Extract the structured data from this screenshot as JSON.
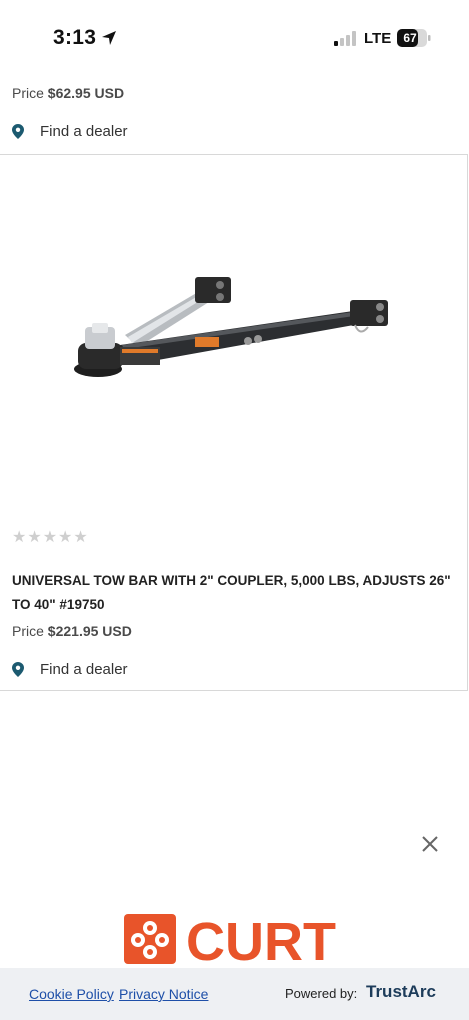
{
  "status_bar": {
    "time": "3:13",
    "network": "LTE",
    "battery": "67"
  },
  "prev_product": {
    "price_label": "Price",
    "price": "$62.95 USD",
    "dealer_link": "Find a dealer"
  },
  "product": {
    "rating_stars": "★★★★★",
    "rating_value": 0,
    "title": "UNIVERSAL TOW BAR WITH 2\" COUPLER, 5,000 LBS, ADJUSTS 26\" TO 40\" #19750",
    "price_label": "Price",
    "price": "$221.95 USD",
    "dealer_link": "Find a dealer"
  },
  "brand": {
    "logo_text": "CURT",
    "logo_color": "#e8542a"
  },
  "cookie_footer": {
    "cookie_policy": "Cookie Policy",
    "privacy_notice": "Privacy Notice",
    "powered_by": "Powered by:",
    "provider": "TrustArc"
  },
  "colors": {
    "link": "#1e4fa8",
    "pin": "#1c5a70",
    "footer_bg": "#eef0f3"
  }
}
